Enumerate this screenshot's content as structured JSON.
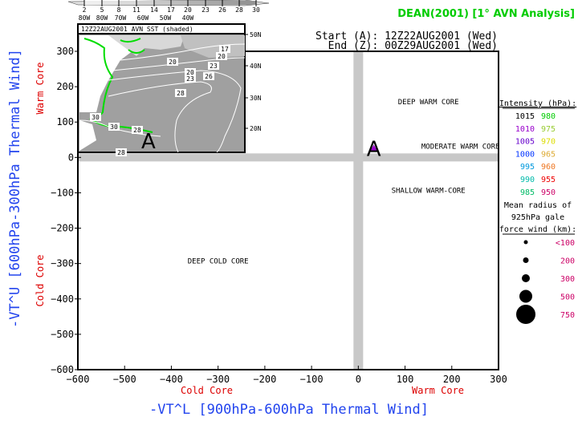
{
  "title": "DEAN(2001) [1° AVN Analysis]",
  "start_label": "Start (A): 12Z22AUG2001 (Wed)",
  "end_label": "End (Z): 00Z29AUG2001 (Wed)",
  "chart_data": {
    "type": "scatter",
    "title": "DEAN(2001) [1° AVN Analysis]",
    "xlabel": "-VT^L [900hPa-600hPa Thermal Wind]",
    "ylabel": "-VT^U [600hPa-300hPa Thermal Wind]",
    "xlim": [
      -600,
      300
    ],
    "ylim": [
      -600,
      300
    ],
    "xticks": [
      -600,
      -500,
      -400,
      -300,
      -200,
      -100,
      0,
      100,
      200,
      300
    ],
    "yticks": [
      300,
      200,
      100,
      0,
      -100,
      -200,
      -300,
      -400,
      -500,
      -600
    ],
    "x_side_labels": {
      "negative": "Cold Core",
      "positive": "Warm Core"
    },
    "y_side_labels": {
      "negative": "Cold Core",
      "positive": "Warm Core"
    },
    "region_labels": [
      {
        "text": "DEEP WARM CORE",
        "x": 150,
        "y": 150
      },
      {
        "text": "MODERATE WARM CORE",
        "x": 150,
        "y": 20
      },
      {
        "text": "SHALLOW WARM-CORE",
        "x": 150,
        "y": -100
      },
      {
        "text": "DEEP COLD CORE",
        "x": -300,
        "y": -300
      }
    ],
    "points": [
      {
        "label": "A",
        "x": 40,
        "y": 20,
        "intensity_hpa": 1010,
        "color": "#9900cc"
      }
    ]
  },
  "legend": {
    "intensity_title": "Intensity (hPa):",
    "intensity": [
      {
        "left": "1015",
        "left_color": "#000000",
        "right": "980",
        "right_color": "#00cc00"
      },
      {
        "left": "1010",
        "left_color": "#9900cc",
        "right": "975",
        "right_color": "#99cc33"
      },
      {
        "left": "1005",
        "left_color": "#6600cc",
        "right": "970",
        "right_color": "#dddd00"
      },
      {
        "left": "1000",
        "left_color": "#0033ff",
        "right": "965",
        "right_color": "#ddaa33"
      },
      {
        "left": "995",
        "left_color": "#0099dd",
        "right": "960",
        "right_color": "#ee7722"
      },
      {
        "left": "990",
        "left_color": "#00bbaa",
        "right": "955",
        "right_color": "#ee0000"
      },
      {
        "left": "985",
        "left_color": "#00bb66",
        "right": "950",
        "right_color": "#cc0066"
      }
    ],
    "radius_title_1": "Mean radius of",
    "radius_title_2": "925hPa gale",
    "radius_title_3": "force wind (km):",
    "radius": [
      "<100",
      "200",
      "300",
      "500",
      "750"
    ],
    "radius_color": "#cc0066"
  },
  "inset": {
    "title": "12Z22AUG2001 AVN SST (shaded)",
    "colorbar_ticks": [
      "2",
      "5",
      "8",
      "11",
      "14",
      "17",
      "20",
      "23",
      "26",
      "28",
      "30"
    ],
    "lon_labels": [
      "80W",
      "80W",
      "70W",
      "60W",
      "50W",
      "40W"
    ],
    "lat_labels": [
      "50N",
      "40N",
      "30N",
      "20N"
    ],
    "contour_labels": [
      "17",
      "20",
      "20",
      "23",
      "20",
      "23",
      "26",
      "28",
      "30",
      "30",
      "28",
      "28"
    ],
    "marker": "A"
  }
}
